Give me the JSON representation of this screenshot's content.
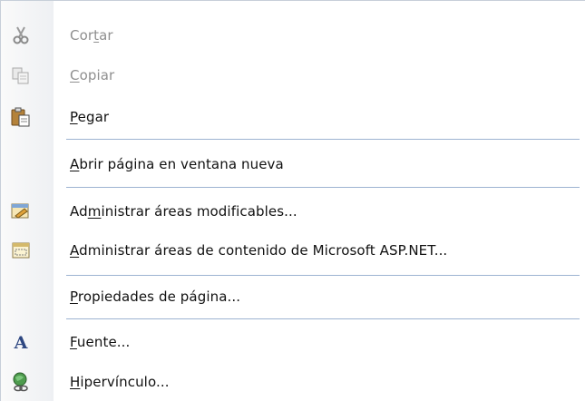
{
  "menu": {
    "items": [
      {
        "label": "Cortar",
        "u": "t",
        "state": "disabled",
        "icon": "scissors-icon"
      },
      {
        "label": "Copiar",
        "u": "C",
        "state": "disabled",
        "icon": "copy-icon"
      },
      {
        "label": "Pegar",
        "u": "P",
        "state": "enabled",
        "icon": "paste-icon"
      },
      {
        "label": "Abrir página en ventana nueva",
        "u": "A",
        "state": "enabled",
        "icon": ""
      },
      {
        "label": "Administrar áreas modificables...",
        "u": "m",
        "state": "enabled",
        "icon": "editable-regions-icon"
      },
      {
        "label": "Administrar áreas de contenido de Microsoft ASP.NET...",
        "u": "A",
        "state": "enabled",
        "icon": "content-regions-icon"
      },
      {
        "label": "Propiedades de página...",
        "u": "P",
        "state": "enabled",
        "icon": ""
      },
      {
        "label": "Fuente...",
        "u": "F",
        "state": "enabled",
        "icon": "font-icon"
      },
      {
        "label": "Hipervínculo...",
        "u": "H",
        "state": "enabled",
        "icon": "hyperlink-icon"
      }
    ]
  },
  "colors": {
    "separator": "#9db3d1",
    "disabled_text": "#8f8f8f",
    "text": "#111111"
  }
}
